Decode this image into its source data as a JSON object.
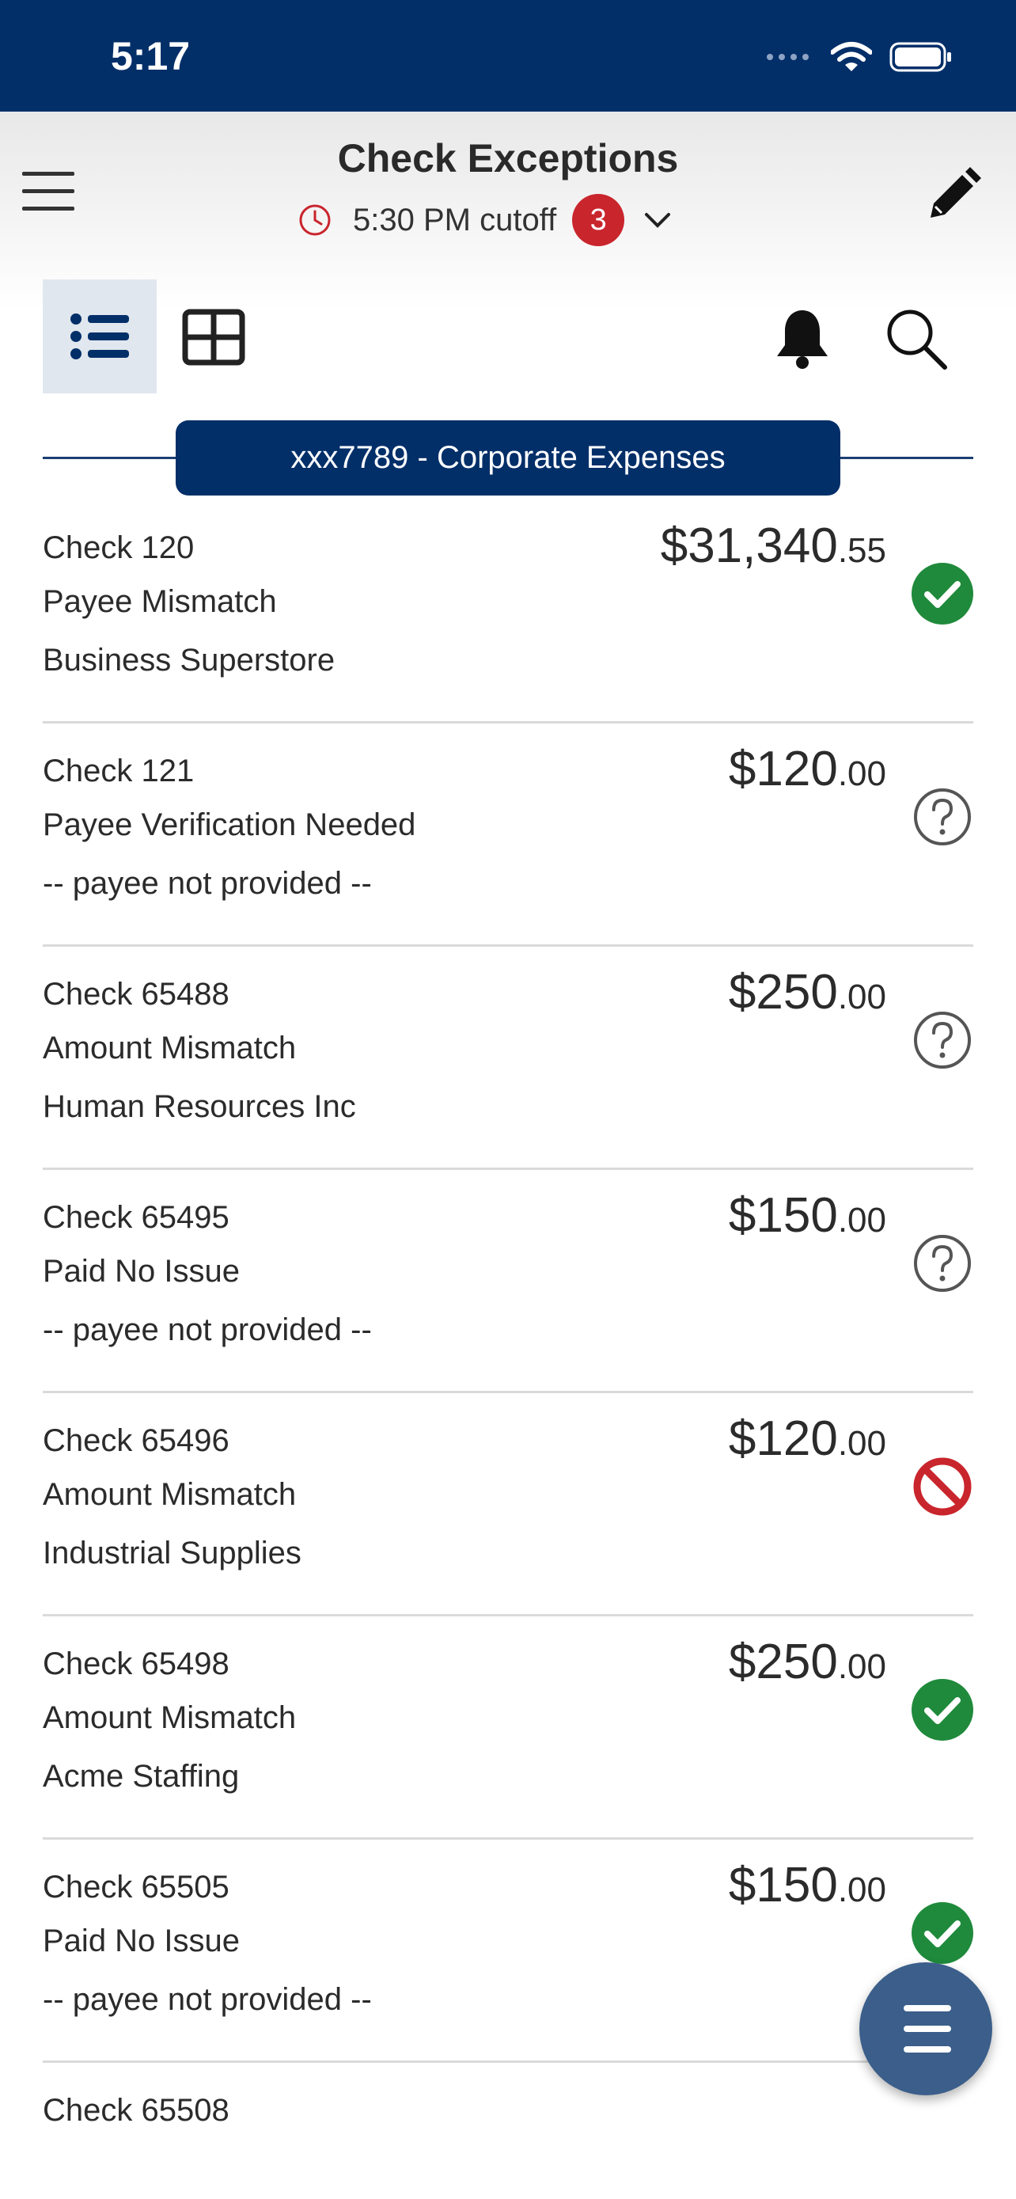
{
  "status_bar": {
    "time": "5:17"
  },
  "header": {
    "title": "Check Exceptions",
    "cutoff": "5:30 PM cutoff",
    "badge_count": "3"
  },
  "toolbar": {
    "list_view_icon": "list-icon",
    "grid_view_icon": "grid-icon",
    "bell_icon": "bell-icon",
    "search_icon": "search-icon"
  },
  "account": {
    "label": "xxx7789 - Corporate Expenses"
  },
  "checks": [
    {
      "check": "Check 120",
      "reason": "Payee Mismatch",
      "payee": "Business Superstore",
      "currency": "$",
      "whole": "31,340",
      "cents": ".55",
      "status": "approved"
    },
    {
      "check": "Check 121",
      "reason": "Payee Verification Needed",
      "payee": "-- payee not provided --",
      "currency": "$",
      "whole": "120",
      "cents": ".00",
      "status": "pending"
    },
    {
      "check": "Check 65488",
      "reason": "Amount Mismatch",
      "payee": "Human Resources Inc",
      "currency": "$",
      "whole": "250",
      "cents": ".00",
      "status": "pending"
    },
    {
      "check": "Check 65495",
      "reason": "Paid No Issue",
      "payee": "-- payee not provided --",
      "currency": "$",
      "whole": "150",
      "cents": ".00",
      "status": "pending"
    },
    {
      "check": "Check 65496",
      "reason": "Amount Mismatch",
      "payee": "Industrial Supplies",
      "currency": "$",
      "whole": "120",
      "cents": ".00",
      "status": "rejected"
    },
    {
      "check": "Check 65498",
      "reason": "Amount Mismatch",
      "payee": "Acme Staffing",
      "currency": "$",
      "whole": "250",
      "cents": ".00",
      "status": "approved"
    },
    {
      "check": "Check 65505",
      "reason": "Paid No Issue",
      "payee": "-- payee not provided --",
      "currency": "$",
      "whole": "150",
      "cents": ".00",
      "status": "approved"
    },
    {
      "check": "Check 65508",
      "reason": "",
      "payee": "",
      "currency": "",
      "whole": "",
      "cents": "",
      "status": ""
    }
  ],
  "colors": {
    "brand_navy": "#032f69",
    "approved_green": "#1f8a3b",
    "rejected_red": "#c9252d",
    "fab_blue": "#3b5e8a"
  },
  "fab": {
    "icon": "menu-icon"
  }
}
